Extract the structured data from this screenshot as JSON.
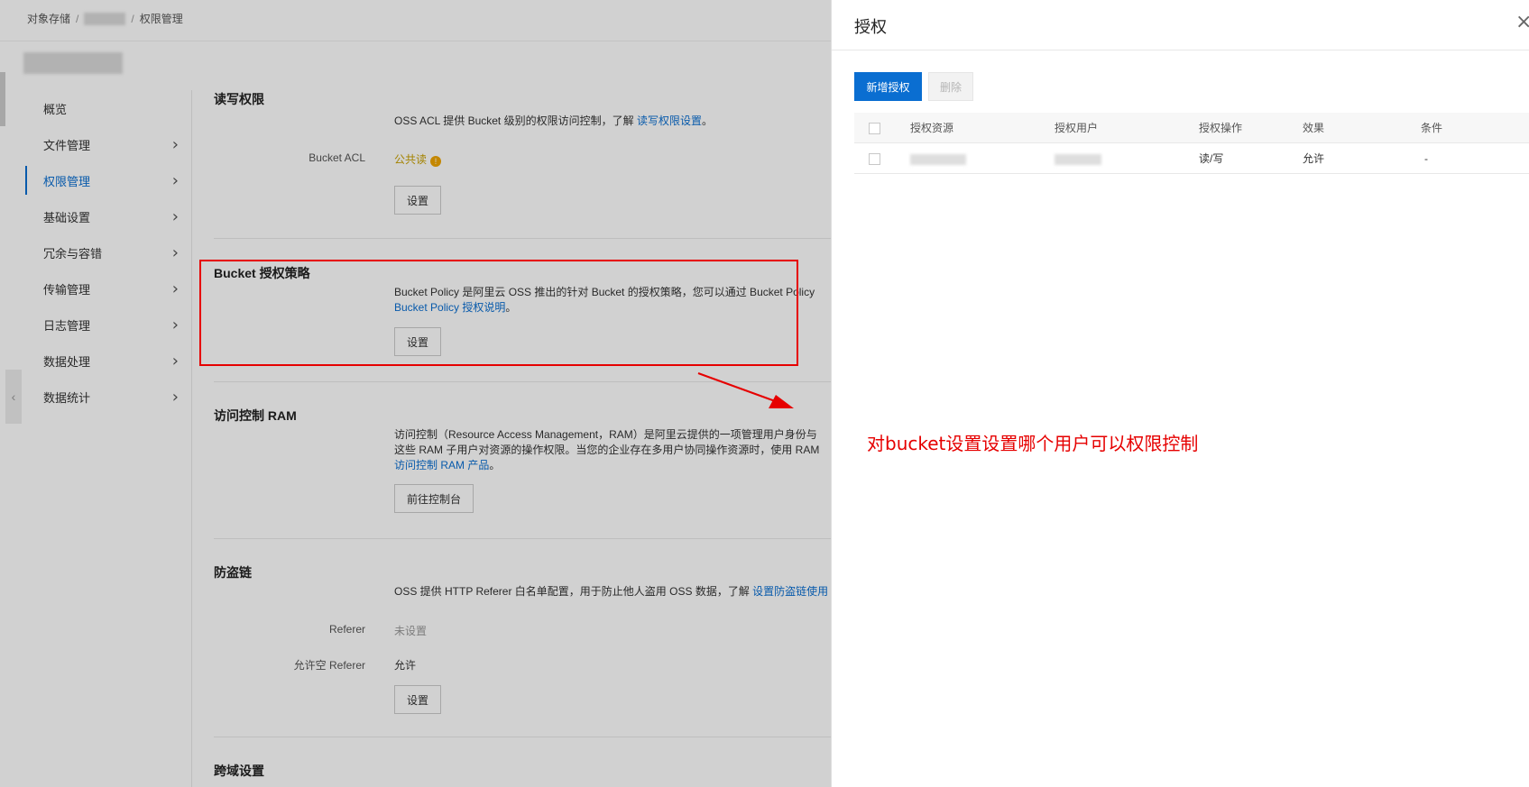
{
  "breadcrumb": {
    "root": "对象存储",
    "current": "权限管理"
  },
  "sidebar": {
    "items": [
      {
        "label": "概览",
        "chevron": ""
      },
      {
        "label": "文件管理",
        "chevron": "›"
      },
      {
        "label": "权限管理",
        "chevron": "›"
      },
      {
        "label": "基础设置",
        "chevron": "›"
      },
      {
        "label": "冗余与容错",
        "chevron": "›"
      },
      {
        "label": "传输管理",
        "chevron": "›"
      },
      {
        "label": "日志管理",
        "chevron": "›"
      },
      {
        "label": "数据处理",
        "chevron": "›"
      },
      {
        "label": "数据统计",
        "chevron": "›"
      }
    ],
    "collapse_glyph": "‹"
  },
  "sections": {
    "rw": {
      "title": "读写权限",
      "desc_prefix": "OSS ACL 提供 Bucket 级别的权限访问控制，了解 ",
      "desc_link": "读写权限设置",
      "desc_suffix": "。",
      "acl_label": "Bucket ACL",
      "acl_value": "公共读",
      "acl_warn": "!",
      "button": "设置"
    },
    "policy": {
      "title": "Bucket 授权策略",
      "desc": "Bucket Policy 是阿里云 OSS 推出的针对 Bucket 的授权策略，您可以通过 Bucket Policy ",
      "desc_link": "Bucket Policy 授权说明",
      "desc_suffix": "。",
      "button": "设置"
    },
    "ram": {
      "title": "访问控制 RAM",
      "desc_line1": "访问控制（Resource Access Management，RAM）是阿里云提供的一项管理用户身份与",
      "desc_line2": "这些 RAM 子用户对资源的操作权限。当您的企业存在多用户协同操作资源时，使用 RAM",
      "desc_link": "访问控制 RAM 产品",
      "desc_suffix": "。",
      "button": "前往控制台"
    },
    "referer": {
      "title": "防盗链",
      "desc_prefix": "OSS 提供 HTTP Referer 白名单配置，用于防止他人盗用 OSS 数据，了解 ",
      "desc_link": "设置防盗链使用",
      "referer_label": "Referer",
      "referer_value": "未设置",
      "empty_label": "允许空 Referer",
      "empty_value": "允许",
      "button": "设置"
    },
    "cors": {
      "title": "跨域设置"
    }
  },
  "drawer": {
    "title": "授权",
    "close_glyph": "×",
    "add_button": "新增授权",
    "delete_button": "删除",
    "columns": [
      "授权资源",
      "授权用户",
      "授权操作",
      "效果",
      "条件"
    ],
    "rows": [
      {
        "resource": "",
        "user": "",
        "action": "读/写",
        "effect": "允许",
        "condition": "-"
      }
    ]
  },
  "annotation": {
    "text": "对bucket设置设置哪个用户可以权限控制",
    "color": "#e60000"
  },
  "colors": {
    "accent": "#0a6ed1",
    "warning": "#f0a500"
  }
}
